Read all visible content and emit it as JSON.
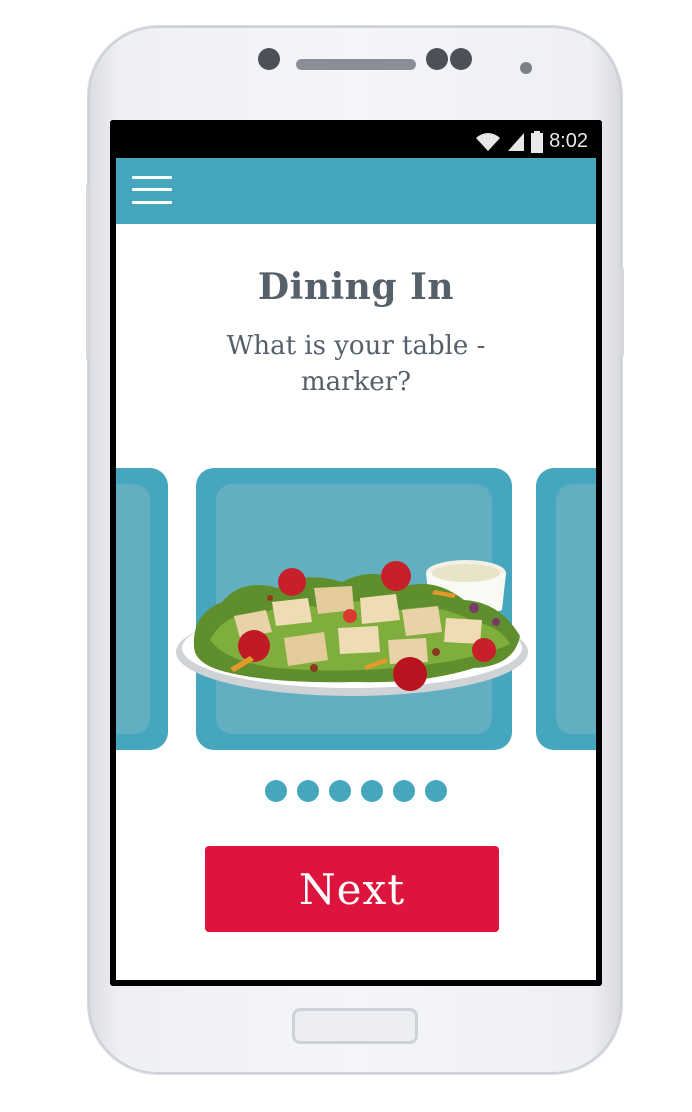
{
  "status_bar": {
    "time": "8:02",
    "icons": [
      "wifi-icon",
      "cell-signal-icon",
      "battery-icon"
    ]
  },
  "app_bar": {
    "menu_icon": "hamburger-menu-icon",
    "color": "#45a6bd"
  },
  "content": {
    "title": "Dining In",
    "subtitle": "What is your table - marker?"
  },
  "carousel": {
    "current_item_image": "chicken-salad-plate",
    "page_count": 6,
    "card_color": "#45a6bd"
  },
  "actions": {
    "next_label": "Next",
    "next_color": "#dd143d"
  }
}
